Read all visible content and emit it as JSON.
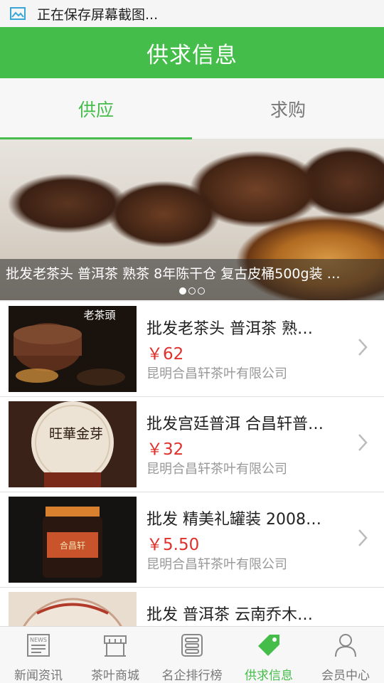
{
  "status_bar": {
    "text": "正在保存屏幕截图...",
    "icon": "screenshot-icon"
  },
  "app_bar": {
    "title": "供求信息"
  },
  "tabs": [
    {
      "label": "供应",
      "active": true
    },
    {
      "label": "求购",
      "active": false
    }
  ],
  "banner": {
    "caption": "批发老茶头 普洱茶 熟茶 8年陈干仓 复古皮桶500g装 …",
    "slides": 3,
    "current_slide": 1
  },
  "products": [
    {
      "name": "批发老茶头 普洱茶 熟…",
      "price": "￥62",
      "company": "昆明合昌轩茶叶有限公司",
      "thumb_text": "老茶頭"
    },
    {
      "name": "批发宫廷普洱 合昌轩普…",
      "price": "￥32",
      "company": "昆明合昌轩茶叶有限公司",
      "thumb_text": "旺華金芽"
    },
    {
      "name": "批发 精美礼罐装 2008…",
      "price": "￥5.50",
      "company": "昆明合昌轩茶叶有限公司",
      "thumb_text": "合昌轩"
    },
    {
      "name": "批发 普洱茶 云南乔木…",
      "price": "",
      "company": "",
      "thumb_text": ""
    }
  ],
  "bottom_nav": [
    {
      "label": "新闻资讯",
      "icon": "news-icon",
      "active": false
    },
    {
      "label": "茶叶商城",
      "icon": "store-icon",
      "active": false
    },
    {
      "label": "名企排行榜",
      "icon": "ranking-icon",
      "active": false
    },
    {
      "label": "供求信息",
      "icon": "tag-icon",
      "active": true
    },
    {
      "label": "会员中心",
      "icon": "user-icon",
      "active": false
    }
  ],
  "colors": {
    "accent": "#45bd4a",
    "price": "#e0302a"
  }
}
